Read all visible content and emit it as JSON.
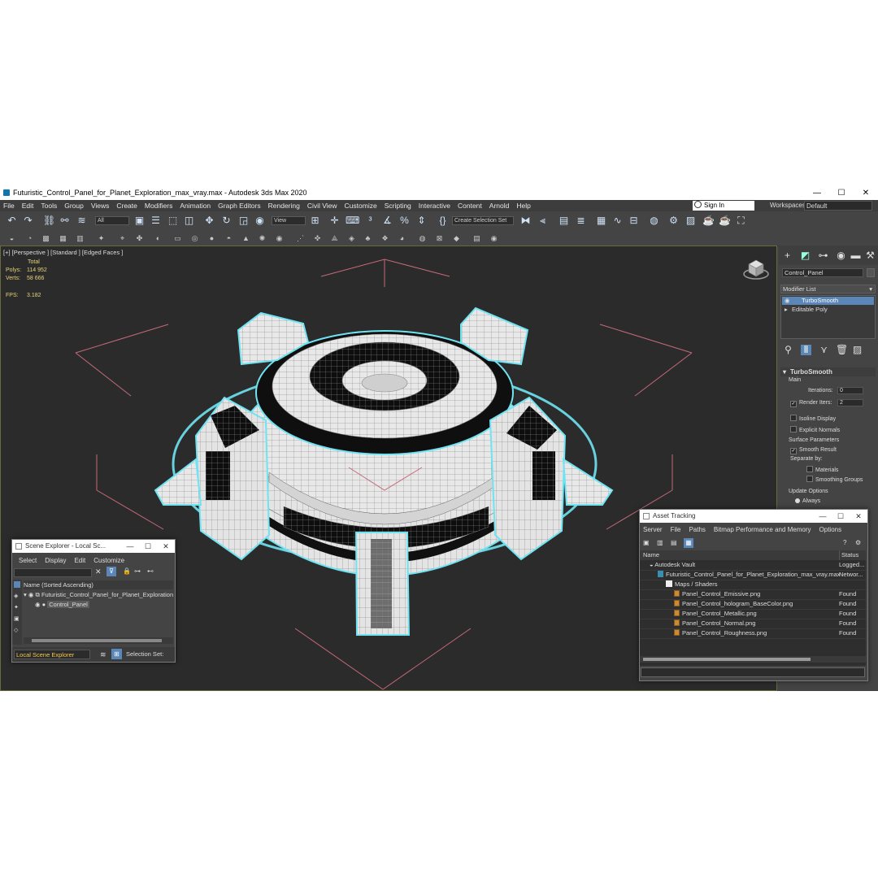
{
  "window": {
    "title": "Futuristic_Control_Panel_for_Planet_Exploration_max_vray.max - Autodesk 3ds Max 2020",
    "minimize": "—",
    "maximize": "☐",
    "close": "✕"
  },
  "menu": {
    "items": [
      "File",
      "Edit",
      "Tools",
      "Group",
      "Views",
      "Create",
      "Modifiers",
      "Animation",
      "Graph Editors",
      "Rendering",
      "Civil View",
      "Customize",
      "Scripting",
      "Interactive",
      "Content",
      "Arnold",
      "Help"
    ],
    "sign_in": "Sign In",
    "workspaces_label": "Workspaces:",
    "workspaces_value": "Default"
  },
  "toolbar": {
    "filter_value": "All",
    "ref_coord_value": "View",
    "selection_set_placeholder": "Create Selection Set"
  },
  "viewport": {
    "label": "[+] [Perspective ] [Standard ] [Edged Faces ]",
    "stats": {
      "total_label": "Total",
      "polys_label": "Polys:",
      "polys_value": "114 952",
      "verts_label": "Verts:",
      "verts_value": "58 666",
      "fps_label": "FPS:",
      "fps_value": "3.182"
    },
    "colors": {
      "bg": "#2b2b2b",
      "selection_outline": "#6fe3f2",
      "bbox": "#c46a78"
    }
  },
  "command_panel": {
    "object_name": "Control_Panel",
    "modifier_list_label": "Modifier List",
    "stack": [
      "TurboSmooth",
      "Editable Poly"
    ],
    "rollout_title": "TurboSmooth",
    "main_label": "Main",
    "iterations_label": "Iterations:",
    "iterations_value": "0",
    "render_iters_label": "Render Iters:",
    "render_iters_value": "2",
    "isoline_label": "Isoline Display",
    "explicit_normals_label": "Explicit Normals",
    "surface_params_label": "Surface Parameters",
    "smooth_result_label": "Smooth Result",
    "separate_by_label": "Separate by:",
    "materials_label": "Materials",
    "smoothing_groups_label": "Smoothing Groups",
    "update_options_label": "Update Options",
    "always_label": "Always"
  },
  "scene_explorer": {
    "title": "Scene Explorer - Local Sc...",
    "menu": [
      "Select",
      "Display",
      "Edit",
      "Customize"
    ],
    "column_header": "Name (Sorted Ascending)",
    "root": "Futuristic_Control_Panel_for_Planet_Exploration",
    "child": "Control_Panel",
    "footer_explorer": "Local Scene Explorer",
    "footer_selection": "Selection Set:"
  },
  "asset_tracking": {
    "title": "Asset Tracking",
    "menu": [
      "Server",
      "File",
      "Paths",
      "Bitmap Performance and Memory",
      "Options"
    ],
    "col_name": "Name",
    "col_status": "Status",
    "rows": [
      {
        "name": "Autodesk Vault",
        "status": "Logged..."
      },
      {
        "name": "Futuristic_Control_Panel_for_Planet_Exploration_max_vray.max",
        "status": "Networ..."
      },
      {
        "name": "Maps / Shaders",
        "status": ""
      },
      {
        "name": "Panel_Control_Emissive.png",
        "status": "Found"
      },
      {
        "name": "Panel_Control_hologram_BaseColor.png",
        "status": "Found"
      },
      {
        "name": "Panel_Control_Metallic.png",
        "status": "Found"
      },
      {
        "name": "Panel_Control_Normal.png",
        "status": "Found"
      },
      {
        "name": "Panel_Control_Roughness.png",
        "status": "Found"
      }
    ]
  }
}
